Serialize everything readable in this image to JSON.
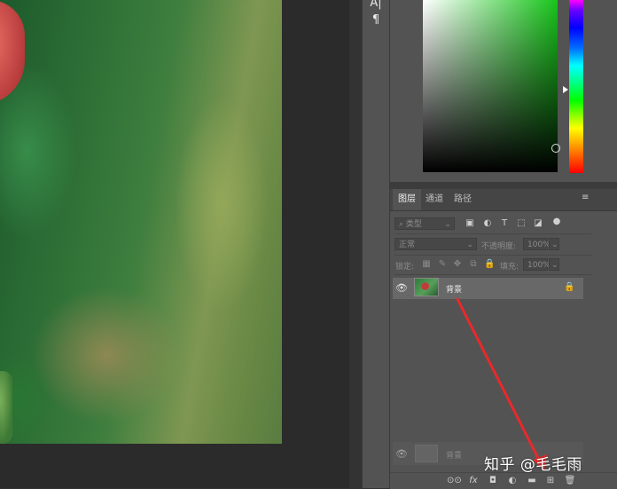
{
  "tool_strip": {
    "icons": [
      "A|",
      "¶"
    ]
  },
  "layers_panel": {
    "tabs": [
      "图层",
      "通道",
      "路径"
    ],
    "filter": {
      "kind_label": "类型"
    },
    "blend": {
      "mode": "正常",
      "opacity_label": "不透明度:",
      "opacity_value": "100%"
    },
    "lock": {
      "label": "锁定:",
      "fill_label": "填充:",
      "fill_value": "100%"
    },
    "layers": [
      {
        "name": "背景",
        "visible": true,
        "locked": true
      }
    ],
    "ghost_layer": {
      "name": "背景"
    },
    "bottom_icons": [
      "link-layers-icon",
      "fx-icon",
      "add-mask-icon",
      "adjustment-layer-icon",
      "new-group-icon",
      "new-layer-icon",
      "delete-layer-icon"
    ],
    "bottom_glyphs": [
      "⊙⊙",
      "fx",
      "◘",
      "◐",
      "▬",
      "⊞",
      "🗑"
    ]
  },
  "color_picker": {
    "field_hue": "#18c41b"
  },
  "watermark": "知乎 @毛毛雨",
  "annotation": {
    "color": "#e8292b"
  }
}
